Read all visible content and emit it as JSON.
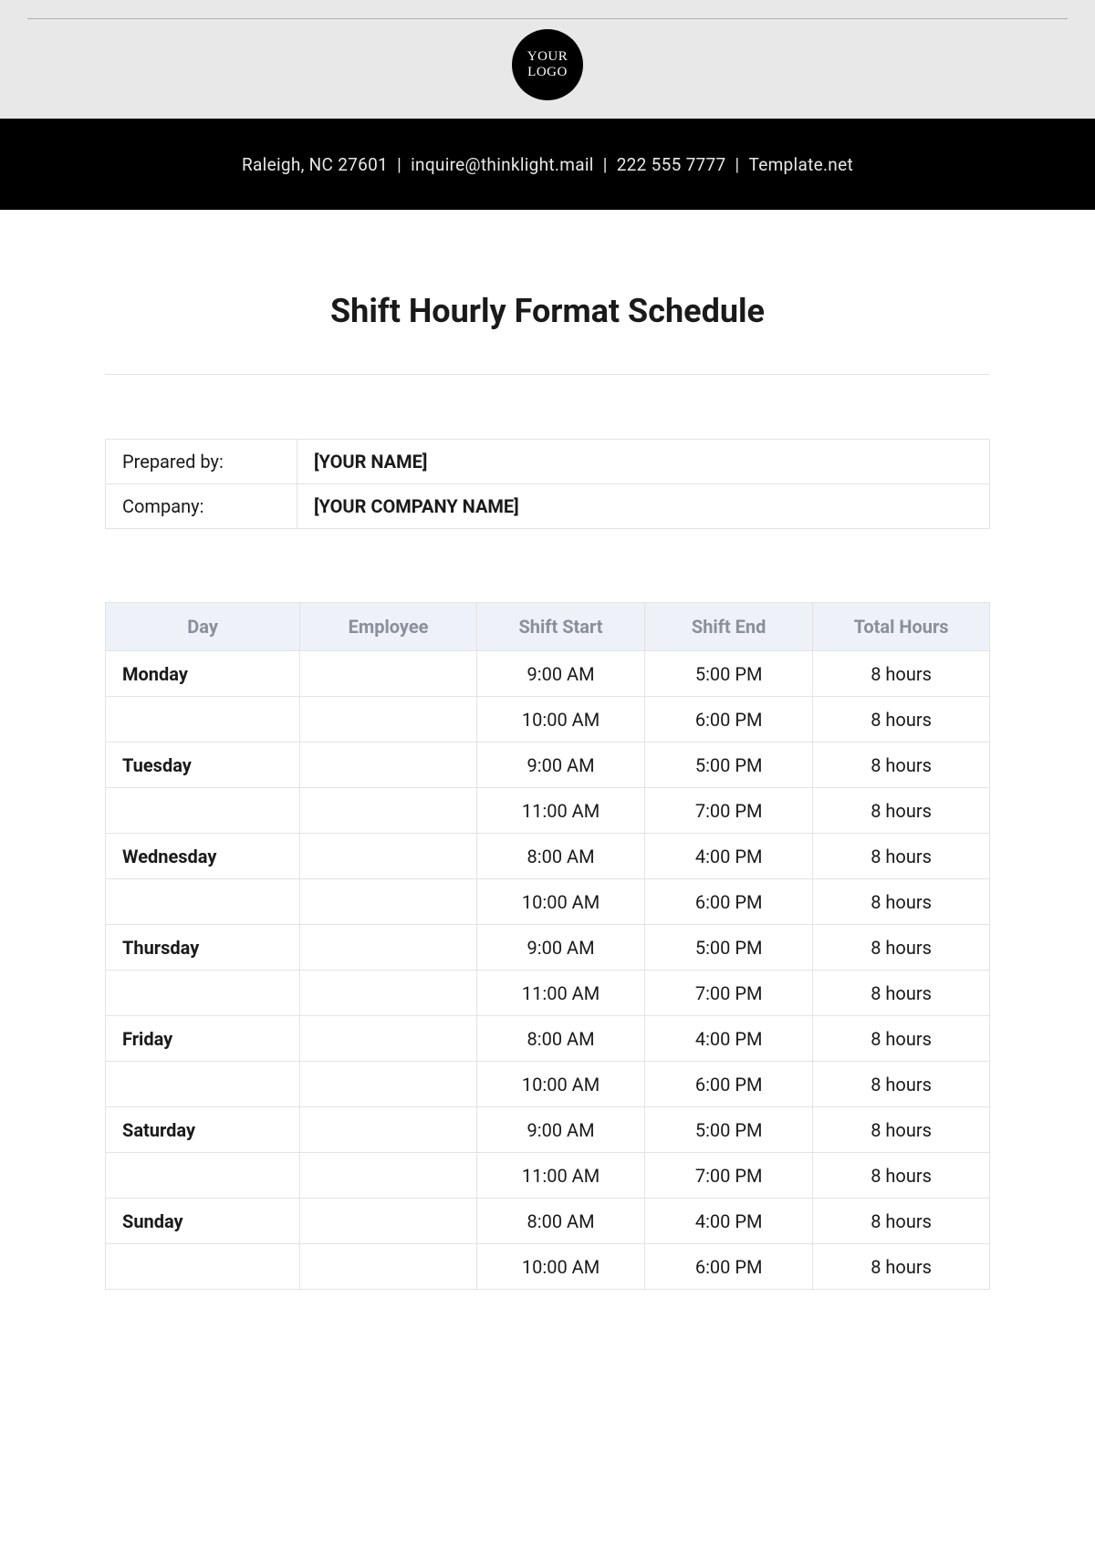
{
  "logo": {
    "line1": "YOUR",
    "line2": "LOGO"
  },
  "header": {
    "address": "Raleigh, NC 27601",
    "email": "inquire@thinklight.mail",
    "phone": "222 555 7777",
    "site": "Template.net",
    "sep": "  |  "
  },
  "title": "Shift Hourly Format Schedule",
  "meta": {
    "prepared_label": "Prepared by:",
    "prepared_value": "[YOUR NAME]",
    "company_label": "Company:",
    "company_value": "[YOUR COMPANY NAME]"
  },
  "columns": {
    "day": "Day",
    "employee": "Employee",
    "start": "Shift Start",
    "end": "Shift End",
    "total": "Total Hours"
  },
  "rows": [
    {
      "day": "Monday",
      "employee": "",
      "start": "9:00 AM",
      "end": "5:00 PM",
      "total": "8 hours"
    },
    {
      "day": "",
      "employee": "",
      "start": "10:00 AM",
      "end": "6:00 PM",
      "total": "8 hours"
    },
    {
      "day": "Tuesday",
      "employee": "",
      "start": "9:00 AM",
      "end": "5:00 PM",
      "total": "8 hours"
    },
    {
      "day": "",
      "employee": "",
      "start": "11:00 AM",
      "end": "7:00 PM",
      "total": "8 hours"
    },
    {
      "day": "Wednesday",
      "employee": "",
      "start": "8:00 AM",
      "end": "4:00 PM",
      "total": "8 hours"
    },
    {
      "day": "",
      "employee": "",
      "start": "10:00 AM",
      "end": "6:00 PM",
      "total": "8 hours"
    },
    {
      "day": "Thursday",
      "employee": "",
      "start": "9:00 AM",
      "end": "5:00 PM",
      "total": "8 hours"
    },
    {
      "day": "",
      "employee": "",
      "start": "11:00 AM",
      "end": "7:00 PM",
      "total": "8 hours"
    },
    {
      "day": "Friday",
      "employee": "",
      "start": "8:00 AM",
      "end": "4:00 PM",
      "total": "8 hours"
    },
    {
      "day": "",
      "employee": "",
      "start": "10:00 AM",
      "end": "6:00 PM",
      "total": "8 hours"
    },
    {
      "day": "Saturday",
      "employee": "",
      "start": "9:00 AM",
      "end": "5:00 PM",
      "total": "8 hours"
    },
    {
      "day": "",
      "employee": "",
      "start": "11:00 AM",
      "end": "7:00 PM",
      "total": "8 hours"
    },
    {
      "day": "Sunday",
      "employee": "",
      "start": "8:00 AM",
      "end": "4:00 PM",
      "total": "8 hours"
    },
    {
      "day": "",
      "employee": "",
      "start": "10:00 AM",
      "end": "6:00 PM",
      "total": "8 hours"
    }
  ]
}
